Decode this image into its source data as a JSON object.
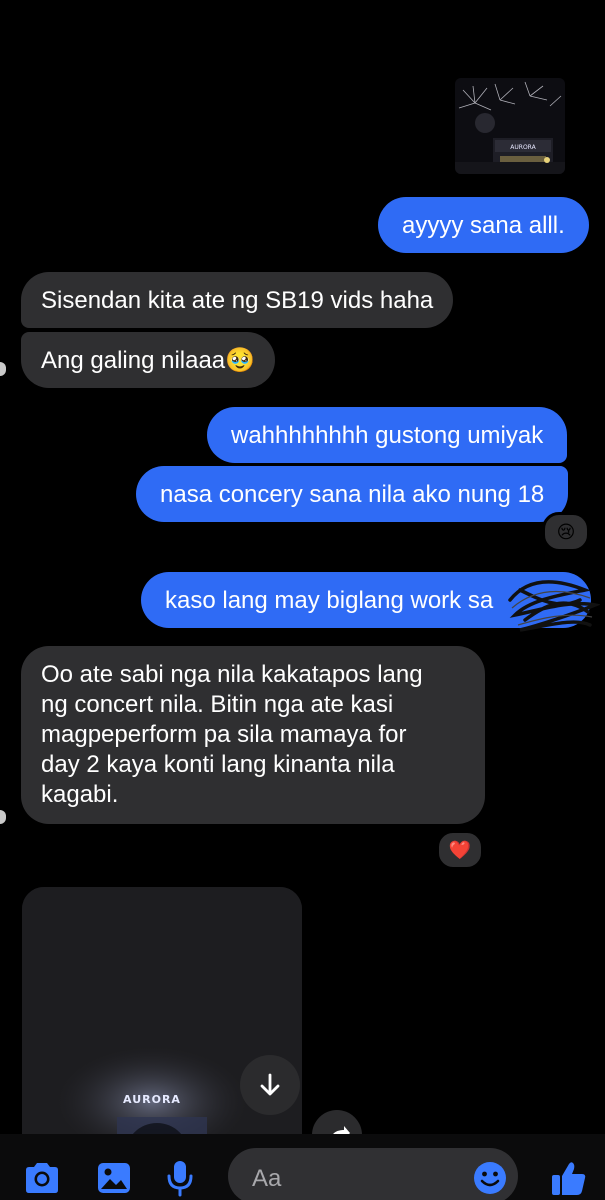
{
  "messages": {
    "m1": "ayyyy sana alll.",
    "m2": "Sisendan kita ate ng SB19 vids haha",
    "m3": "Ang galing nilaaa🥹",
    "m4": "wahhhhhhhh gustong umiyak",
    "m5": "nasa concery sana nila ako nung 18",
    "m6": "kaso lang may biglang work sa",
    "m7_lines": [
      "Oo ate sabi nga nila kakatapos lang",
      "ng concert nila. Bitin nga ate kasi",
      "magpeperform pa sila mamaya for",
      "day 2 kaya konti lang kinanta nila",
      "kagabi."
    ]
  },
  "reactions": {
    "m5": "😢",
    "m7": "❤️"
  },
  "photo": {
    "sign_text": "AURORA"
  },
  "video": {
    "sign_text": "AURORA"
  },
  "composer": {
    "placeholder": "Aa",
    "icons": [
      "camera-icon",
      "image-icon",
      "microphone-icon",
      "emoji-icon",
      "thumbs-up-icon"
    ]
  },
  "colors": {
    "sent_bubble": "#2f6bf5",
    "received_bubble": "#2f2f31",
    "accent": "#3a7bff",
    "background": "#000000"
  }
}
